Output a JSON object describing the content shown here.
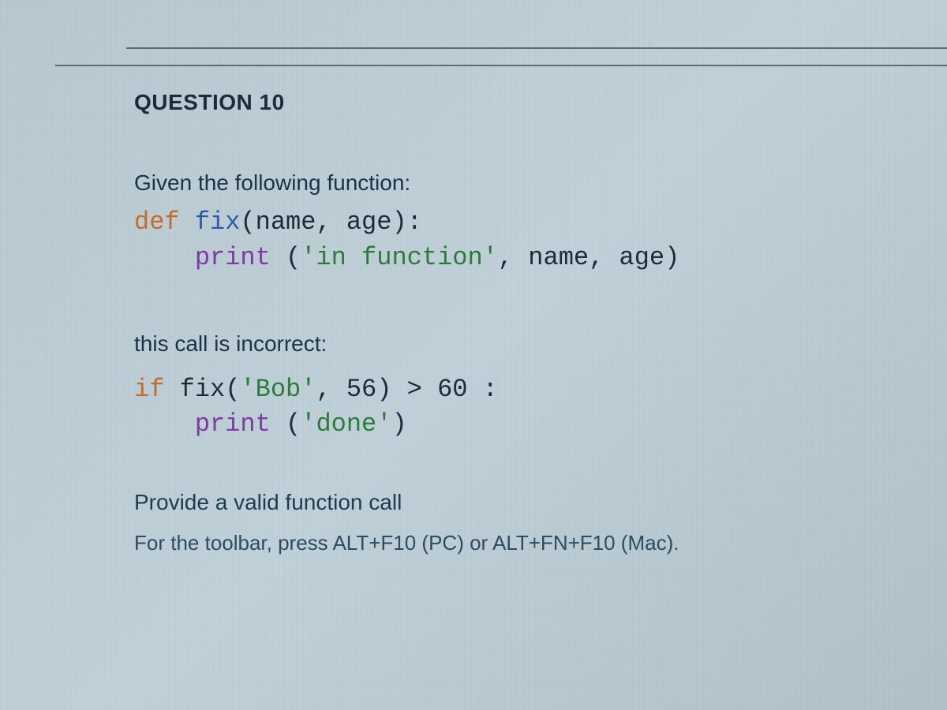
{
  "question": {
    "heading": "QUESTION 10",
    "intro": "Given the following function:",
    "code1": {
      "kw_def": "def",
      "fn_name": " fix",
      "params": "(name, age):",
      "indent": "    ",
      "kw_print": "print",
      "space_paren": " (",
      "str1": "'in function'",
      "rest1": ", name, age)"
    },
    "mid": "this call is incorrect:",
    "code2": {
      "kw_if": "if",
      "call": " fix(",
      "str_bob": "'Bob'",
      "after_bob": ", 56) > 60 :",
      "indent": "    ",
      "kw_print": "print",
      "space_paren": " (",
      "str_done": "'done'",
      "close": ")"
    },
    "prompt": "Provide a valid function call",
    "toolbar_hint": "For the toolbar, press ALT+F10 (PC) or ALT+FN+F10 (Mac)."
  }
}
